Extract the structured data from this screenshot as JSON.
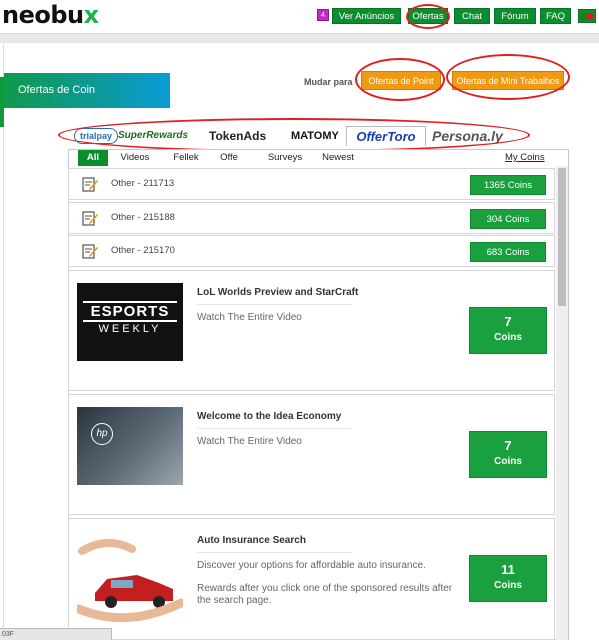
{
  "header": {
    "logo": "neobux",
    "badge": "4",
    "nav": [
      "Ver Anúncios",
      "Ofertas",
      "Chat",
      "Fórum",
      "FAQ"
    ]
  },
  "panel": {
    "tab_label": "Ofertas de Coin",
    "mudar_label": "Mudar para",
    "switch_point": "Ofertas de Point",
    "switch_mini": "Ofertas de Mini Trabalhos"
  },
  "partners": [
    "trialpay",
    "SuperRewards",
    "TokenAds",
    "MATOMY",
    "OfferToro",
    "Persona.ly"
  ],
  "filters": {
    "tabs": [
      "All",
      "Videos",
      "Fellek",
      "Offe",
      "Surveys",
      "Newest"
    ],
    "my_coins": "My Coins"
  },
  "rows": [
    {
      "label": "Other - 211713",
      "coins": "1365 Coins"
    },
    {
      "label": "Other - 215188",
      "coins": "304 Coins"
    },
    {
      "label": "Other - 215170",
      "coins": "683 Coins"
    }
  ],
  "cards": [
    {
      "title": "LoL Worlds Preview and StarCraft",
      "desc": "Watch The Entire Video",
      "desc2": "",
      "value": "7",
      "unit": "Coins",
      "thumb_text": "ESPORTS",
      "thumb_text2": "WEEKLY"
    },
    {
      "title": "Welcome to the Idea Economy",
      "desc": "Watch The Entire Video",
      "desc2": "",
      "value": "7",
      "unit": "Coins",
      "thumb_text": "hp",
      "thumb_text2": ""
    },
    {
      "title": "Auto Insurance Search",
      "desc": "Discover your options for affordable auto insurance.",
      "desc2": "Rewards after you click one of the sponsored results after the search page.",
      "value": "11",
      "unit": "Coins",
      "thumb_text": "",
      "thumb_text2": ""
    }
  ],
  "status": "03F",
  "colors": {
    "green": "#1aa03e",
    "orange": "#f09a14",
    "red_ring": "#e02020"
  }
}
